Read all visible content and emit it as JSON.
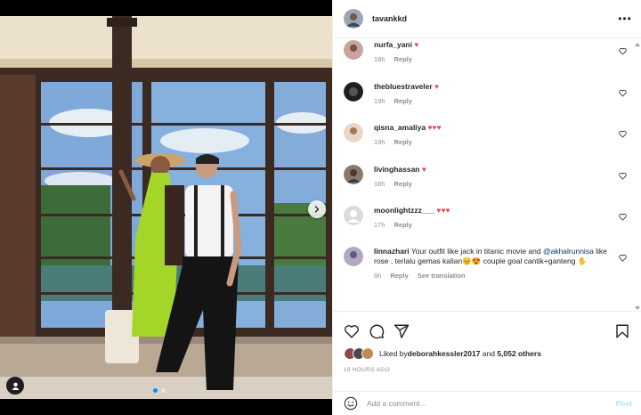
{
  "post": {
    "username": "tavankkd",
    "more_glyph": "•••"
  },
  "colors": {
    "accent": "#0095f6",
    "heart": "#ed4956",
    "muted": "#8e8e8e",
    "text": "#262626",
    "post_disabled": "#b2dffc"
  },
  "comments": [
    {
      "user": "nurfa_yani",
      "text": "",
      "hearts": "♥",
      "time": "18h",
      "reply": "Reply",
      "avatar": "#c9a29a"
    },
    {
      "user": "thebluestraveler",
      "text": "",
      "hearts": "♥",
      "time": "19h",
      "reply": "Reply",
      "avatar": "#222222"
    },
    {
      "user": "qisna_amaliya",
      "text": "",
      "hearts": "♥♥♥",
      "time": "19h",
      "reply": "Reply",
      "avatar": "#d8b49a"
    },
    {
      "user": "livinghassan",
      "text": "",
      "hearts": "♥",
      "time": "18h",
      "reply": "Reply",
      "avatar": "#6b5a4a"
    },
    {
      "user": "moonlightzzz___",
      "text": "",
      "hearts": "♥♥♥",
      "time": "17h",
      "reply": "Reply",
      "avatar": "#dbdbdb"
    }
  ],
  "long_comment": {
    "user": "linnazhari",
    "text_1": "Your outfit like jack in titanic movie and",
    "mention": "@akhalrunnisa",
    "text_2": " like rose , terlalu gemas kalian😣😍 couple goal cantik+ganteng ✋",
    "time": "6h",
    "reply": "Reply",
    "see_translation": "See translation",
    "avatar": "#7a6e8a"
  },
  "likes": {
    "prefix": "Liked by ",
    "user": "deborahkessler2017",
    "middle": " and ",
    "count": "5,052 others"
  },
  "date": "19 HOURS AGO",
  "add_comment": {
    "placeholder": "Add a comment...",
    "post_label": "Post"
  },
  "icons": {
    "heart": "heart-icon",
    "comment": "comment-icon",
    "share": "share-icon",
    "save": "bookmark-icon",
    "emoji": "emoji-icon",
    "next": "chevron-right-icon",
    "tag": "user-tag-icon",
    "more": "more-icon"
  },
  "carousel": {
    "slides": 2,
    "active": 1
  }
}
